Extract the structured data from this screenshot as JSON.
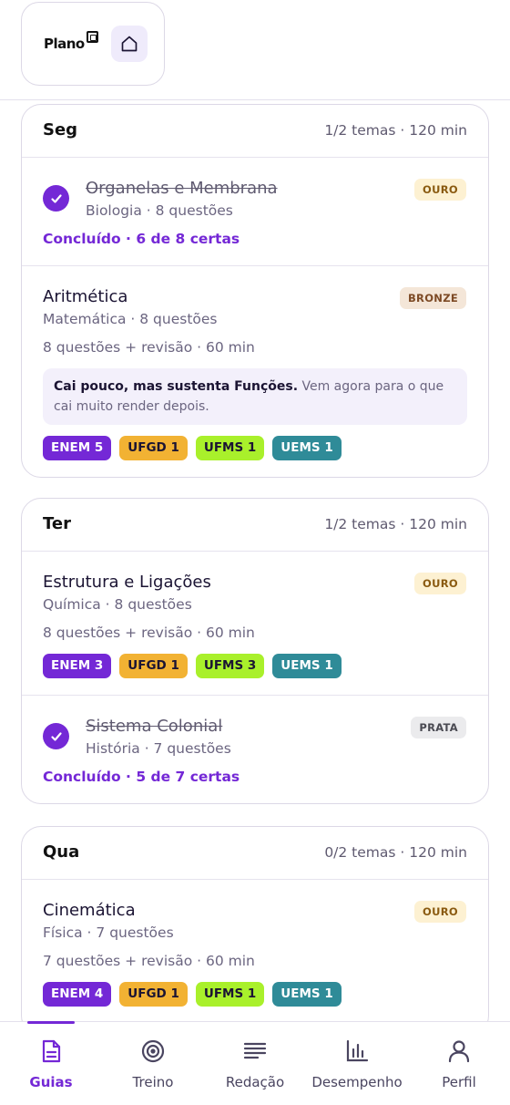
{
  "header": {
    "brand": "Plano",
    "home_icon": "home-icon"
  },
  "days": [
    {
      "name": "Seg",
      "meta": "1/2 temas · 120 min",
      "topics": [
        {
          "title": "Organelas e Membrana",
          "subtitle": "Biologia · 8 questões",
          "status": "Concluído · 6 de 8 certas",
          "medal": "OURO",
          "done": true
        },
        {
          "title": "Aritmética",
          "subtitle": "Matemática · 8 questões",
          "detail": "8 questões + revisão · 60 min",
          "medal": "BRONZE",
          "note_bold": "Cai pouco, mas sustenta Funções.",
          "note_text": " Vem agora para o que cai muito render depois.",
          "chips": [
            "ENEM 5",
            "UFGD 1",
            "UFMS 1",
            "UEMS 1"
          ]
        }
      ]
    },
    {
      "name": "Ter",
      "meta": "1/2 temas · 120 min",
      "topics": [
        {
          "title": "Estrutura e Ligações",
          "subtitle": "Química · 8 questões",
          "detail": "8 questões + revisão · 60 min",
          "medal": "OURO",
          "chips": [
            "ENEM 3",
            "UFGD 1",
            "UFMS 3",
            "UEMS 1"
          ]
        },
        {
          "title": "Sistema Colonial",
          "subtitle": "História · 7 questões",
          "status": "Concluído · 5 de 7 certas",
          "medal": "PRATA",
          "done": true
        }
      ]
    },
    {
      "name": "Qua",
      "meta": "0/2 temas · 120 min",
      "topics": [
        {
          "title": "Cinemática",
          "subtitle": "Física · 7 questões",
          "detail": "7 questões + revisão · 60 min",
          "medal": "OURO",
          "chips": [
            "ENEM 4",
            "UFGD 1",
            "UFMS 1",
            "UEMS 1"
          ]
        }
      ]
    }
  ],
  "nav": {
    "items": [
      {
        "label": "Guias",
        "icon": "document-icon",
        "active": true
      },
      {
        "label": "Treino",
        "icon": "target-icon"
      },
      {
        "label": "Redação",
        "icon": "text-lines-icon"
      },
      {
        "label": "Desempenho",
        "icon": "bar-chart-icon"
      },
      {
        "label": "Perfil",
        "icon": "user-icon"
      }
    ]
  },
  "colors": {
    "accent": "#7428d6",
    "enem": "#7428d6",
    "ufgd": "#f2b233",
    "ufms": "#a9f02b",
    "uems": "#2f8b98"
  }
}
